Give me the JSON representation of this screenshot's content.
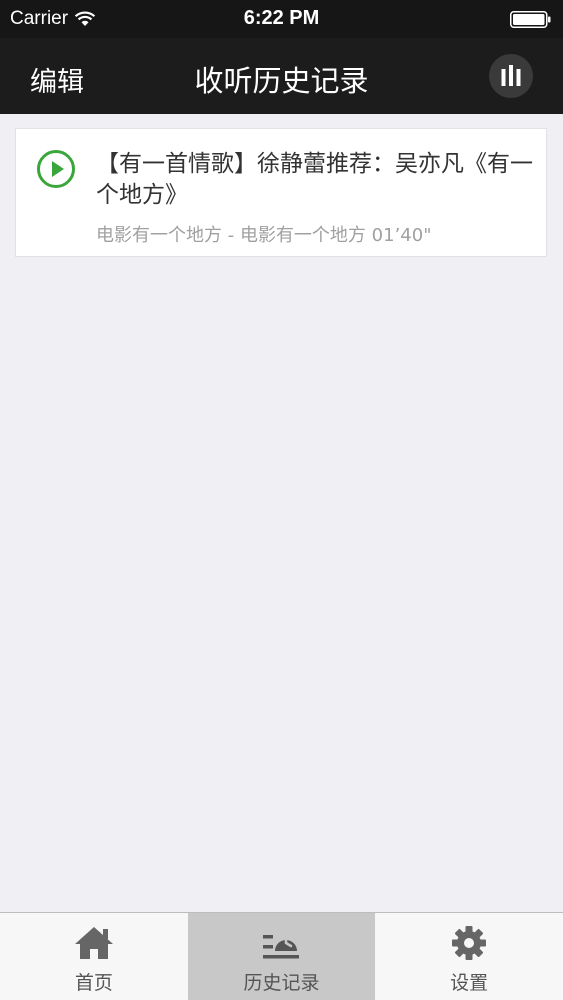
{
  "status_bar": {
    "carrier": "Carrier",
    "time": "6:22 PM"
  },
  "nav": {
    "edit_label": "编辑",
    "title": "收听历史记录",
    "now_playing_icon": "equalizer-icon"
  },
  "history": {
    "items": [
      {
        "title": "【有一首情歌】徐静蕾推荐：吴亦凡《有一个地方》",
        "subtitle": "电影有一个地方 - 电影有一个地方  01’40\"",
        "icon": "play-circle-icon"
      }
    ]
  },
  "tab_bar": {
    "tabs": [
      {
        "label": "首页",
        "icon": "home-icon",
        "active": false
      },
      {
        "label": "历史记录",
        "icon": "history-icon",
        "active": true
      },
      {
        "label": "设置",
        "icon": "gear-icon",
        "active": false
      }
    ]
  },
  "colors": {
    "accent_green": "#3aa53a",
    "nav_background": "#1c1c1c",
    "page_background": "#efeff4"
  }
}
